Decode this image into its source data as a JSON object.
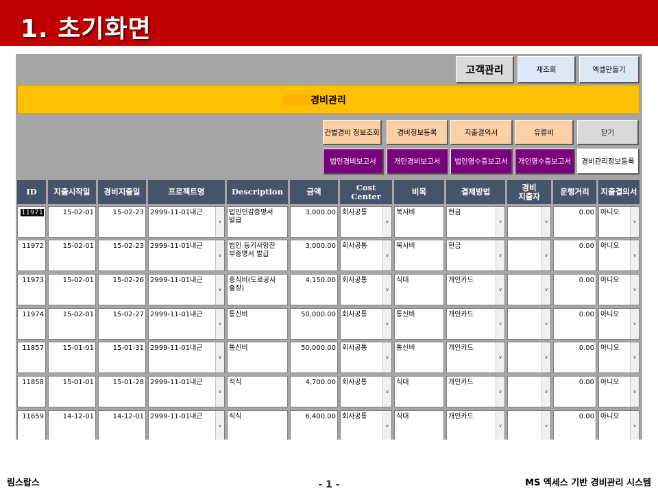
{
  "slide": {
    "title": "1. 초기화면",
    "footer_left": "림스랍스",
    "page_number": "- 1 -",
    "footer_right": "MS 엑세스 기반 경비관리 시스템"
  },
  "toolbar": {
    "customer_button": "고객관리",
    "requery_button": "재조회",
    "excel_button": "엑셀만들기"
  },
  "form_title": "경비관리",
  "action_buttons": {
    "case_expense_lookup": "건별경비 정보조회",
    "expense_info_register": "경비정보등록",
    "expenditure_resolution": "지출결의서",
    "fuel_cost": "유류비",
    "close": "닫기",
    "corporate_expense_report": "법인경비보고서",
    "personal_expense_report": "개인경비보고서",
    "corporate_receipt_report": "법인영수증보고서",
    "personal_receipt_report": "개인영수증보고서",
    "expense_mgmt_info_register": "경비관리정보등록"
  },
  "columns": [
    "ID",
    "지출시작일",
    "경비지출일",
    "프로젝트명",
    "Description",
    "금액",
    "Cost\nCenter",
    "비목",
    "결제방법",
    "경비\n지출자",
    "운행거리",
    "지출결의서"
  ],
  "rows": [
    {
      "id": "11971",
      "start": "15-02-01",
      "date": "15-02-23",
      "project": "2999-11-01내근",
      "desc": "법인인감증명서\n발급",
      "amount": "3,000.00",
      "cost_center": "회사공통",
      "category": "복사비",
      "payment": "현금",
      "spender": "",
      "distance": "0.00",
      "resolution": "아니오"
    },
    {
      "id": "11972",
      "start": "15-02-01",
      "date": "15-02-23",
      "project": "2999-11-01내근",
      "desc": "법인 등기사항전\n부증명서 발급",
      "amount": "3,000.00",
      "cost_center": "회사공통",
      "category": "복사비",
      "payment": "현금",
      "spender": "",
      "distance": "0.00",
      "resolution": "아니오"
    },
    {
      "id": "11973",
      "start": "15-02-01",
      "date": "15-02-26",
      "project": "2999-11-01내근",
      "desc": "중식비(도로공사\n출장)",
      "amount": "4,150.00",
      "cost_center": "회사공통",
      "category": "식대",
      "payment": "개인카드",
      "spender": "",
      "distance": "0.00",
      "resolution": "아니오"
    },
    {
      "id": "11974",
      "start": "15-02-01",
      "date": "15-02-27",
      "project": "2999-11-01내근",
      "desc": "통신비",
      "amount": "50,000.00",
      "cost_center": "회사공통",
      "category": "통신비",
      "payment": "개인카드",
      "spender": "",
      "distance": "0.00",
      "resolution": "아니오"
    },
    {
      "id": "11857",
      "start": "15-01-01",
      "date": "15-01-31",
      "project": "2999-11-01내근",
      "desc": "통신비",
      "amount": "50,000.00",
      "cost_center": "회사공통",
      "category": "통신비",
      "payment": "개인카드",
      "spender": "",
      "distance": "0.00",
      "resolution": "아니오"
    },
    {
      "id": "11858",
      "start": "15-01-01",
      "date": "15-01-28",
      "project": "2999-11-01내근",
      "desc": "석식",
      "amount": "4,700.00",
      "cost_center": "회사공통",
      "category": "식대",
      "payment": "개인카드",
      "spender": "",
      "distance": "0.00",
      "resolution": "아니오"
    },
    {
      "id": "11659",
      "start": "14-12-01",
      "date": "14-12-01",
      "project": "2999-11-01내근",
      "desc": "석식",
      "amount": "6,400.00",
      "cost_center": "회사공통",
      "category": "식대",
      "payment": "개인카드",
      "spender": "",
      "distance": "0.00",
      "resolution": "아니오"
    }
  ],
  "colors": {
    "banner": "#c00000",
    "title_bar": "#ffc000",
    "header": "#44546a",
    "purple_button": "#7b007b",
    "peach_button": "#fbd0a6"
  }
}
